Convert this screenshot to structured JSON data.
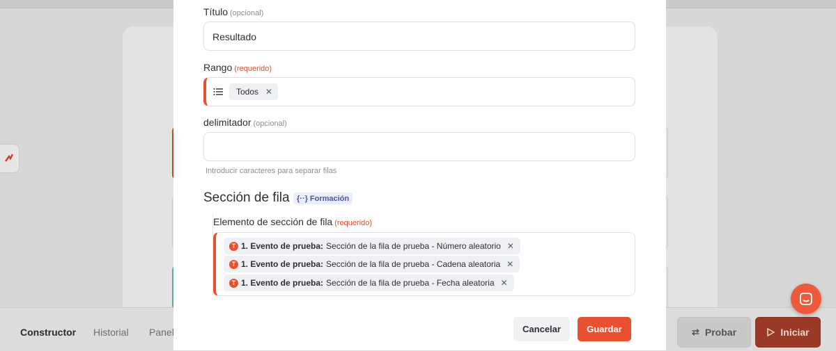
{
  "background": {
    "tabs": [
      "Constructor",
      "Historial",
      "Panel"
    ],
    "probar_label": "Probar",
    "iniciar_label": "Iniciar"
  },
  "modal": {
    "titulo": {
      "label": "Título",
      "hint": "(opcional)",
      "value": "Resultado"
    },
    "rango": {
      "label": "Rango",
      "req": "(requerido)",
      "chip": "Todos",
      "icon": "list-icon"
    },
    "delimitador": {
      "label": "delimitador",
      "hint": "(opcional)",
      "value": "",
      "helper": "Introducir caracteres para separar filas"
    },
    "seccion": {
      "title": "Sección de fila",
      "badge_icon": "{··}",
      "badge": "Formación",
      "element_label": "Elemento de sección de fila",
      "element_req": "(requerido)",
      "items": [
        {
          "event": "1. Evento de prueba:",
          "text": "Sección de la fila de prueba - Número aleatorio"
        },
        {
          "event": "1. Evento de prueba:",
          "text": "Sección de la fila de prueba - Cadena aleatoria"
        },
        {
          "event": "1. Evento de prueba:",
          "text": "Sección de la fila de prueba - Fecha aleatoria"
        }
      ]
    },
    "cancel_label": "Cancelar",
    "save_label": "Guardar"
  },
  "colors": {
    "accent": "#e8502f",
    "badge_text": "#4a55a8"
  }
}
